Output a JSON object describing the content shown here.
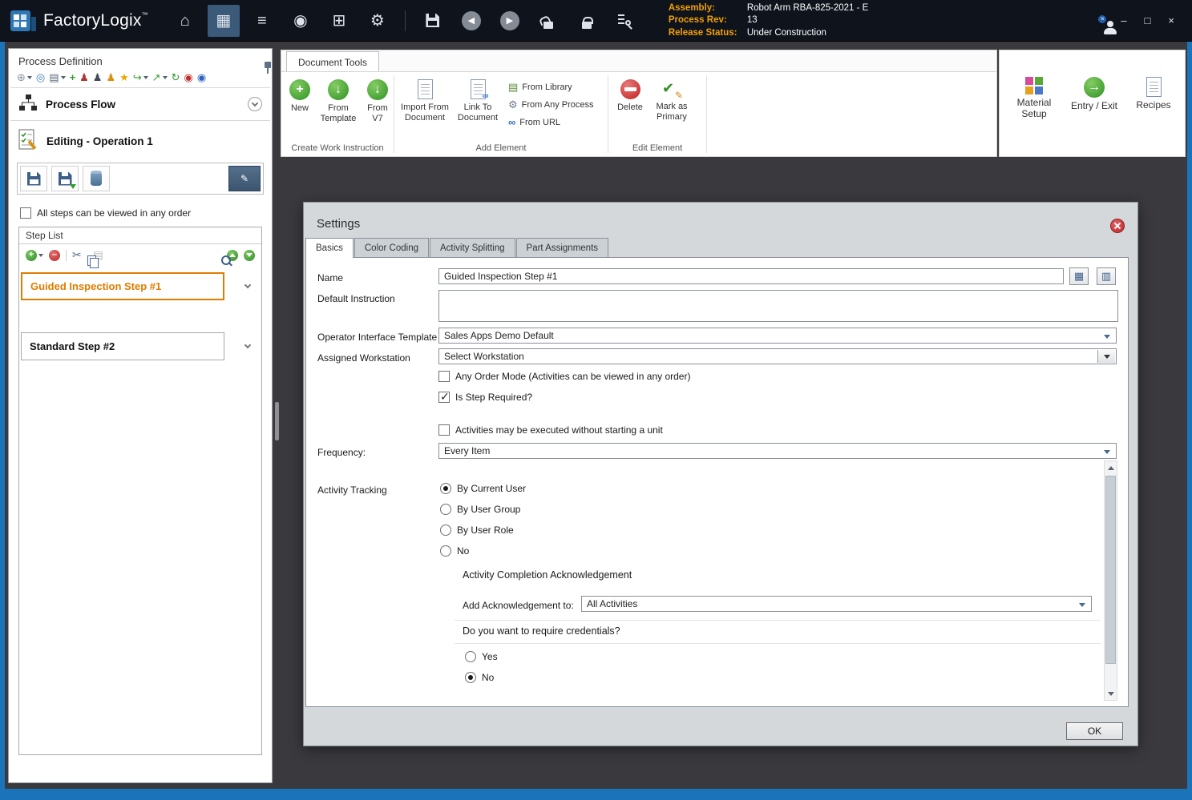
{
  "glyphs": {
    "home": "⌂",
    "work": "▦",
    "steps": "≡",
    "nav": "◉",
    "docs": "⊞",
    "gear": "⚙",
    "back": "◀",
    "fwd": "▶",
    "min": "–",
    "max": "□",
    "close": "×",
    "badge_x": "×",
    "sb": [
      "⊕",
      "◎",
      "▤",
      "+",
      "♟",
      "♟",
      "♟",
      "★",
      "↪",
      "↗",
      "↻",
      "◉",
      "◉"
    ],
    "cut": "✂",
    "paste": "▤",
    "pencil": "✎",
    "lib": "▤",
    "anyproc": "⚙",
    "url": "∞",
    "plus": "+",
    "minus": "–",
    "arrow_dn": "↓",
    "arrow_rt": "→",
    "fieldbtn1": "▦",
    "fieldbtn2": "▥"
  },
  "titlebar": {
    "app_name": "FactoryLogix",
    "trademark": "™",
    "info": {
      "assembly_label": "Assembly:",
      "assembly_value": "Robot Arm RBA-825-2021 - E",
      "process_rev_label": "Process Rev:",
      "process_rev_value": "13",
      "release_status_label": "Release Status:",
      "release_status_value": "Under Construction"
    }
  },
  "sidebar": {
    "title": "Process Definition",
    "process_flow_label": "Process Flow",
    "editing_label": "Editing - Operation 1",
    "any_order_label": "All steps can be viewed in any order",
    "any_order_checked": false,
    "step_list_title": "Step List",
    "steps": [
      {
        "label": "Guided Inspection Step #1",
        "selected": true
      },
      {
        "label": "Standard Step #2",
        "selected": false
      }
    ]
  },
  "ribbon": {
    "tab_label": "Document Tools",
    "create_group": {
      "label": "Create Work Instruction",
      "new": "New",
      "from_template": "From Template",
      "from_v7": "From V7"
    },
    "add_group": {
      "label": "Add Element",
      "import": "Import From Document",
      "link": "Link To Document",
      "from_library": "From Library",
      "from_any_process": "From Any Process",
      "from_url": "From URL"
    },
    "edit_group": {
      "label": "Edit Element",
      "delete": "Delete",
      "mark_primary": "Mark as Primary"
    },
    "right_group": {
      "material_setup": "Material Setup",
      "entry_exit": "Entry / Exit",
      "recipes": "Recipes"
    }
  },
  "dialog": {
    "title": "Settings",
    "tabs": [
      {
        "label": "Basics",
        "active": true
      },
      {
        "label": "Color Coding",
        "active": false
      },
      {
        "label": "Activity Splitting",
        "active": false
      },
      {
        "label": "Part Assignments",
        "active": false
      }
    ],
    "name_label": "Name",
    "name_value": "Guided Inspection Step #1",
    "default_instruction_label": "Default Instruction",
    "default_instruction_value": "",
    "operator_template_label": "Operator Interface Template",
    "operator_template_value": "Sales Apps Demo Default",
    "workstation_label": "Assigned Workstation",
    "workstation_value": "Select Workstation",
    "any_order_mode_label": "Any Order Mode (Activities can be viewed in any order)",
    "any_order_mode_checked": false,
    "step_required_label": "Is Step Required?",
    "step_required_checked": true,
    "no_unit_label": "Activities may be executed without starting a unit",
    "no_unit_checked": false,
    "frequency_label": "Frequency:",
    "frequency_value": "Every Item",
    "activity_tracking_label": "Activity Tracking",
    "tracking_options": [
      {
        "label": "By Current User",
        "selected": true
      },
      {
        "label": "By User Group",
        "selected": false
      },
      {
        "label": "By User Role",
        "selected": false
      },
      {
        "label": "No",
        "selected": false
      }
    ],
    "ack_heading": "Activity Completion Acknowledgement",
    "ack_label": "Add Acknowledgement to:",
    "ack_value": "All Activities",
    "credentials_question": "Do you want to require credentials?",
    "credentials_options": [
      {
        "label": "Yes",
        "selected": false
      },
      {
        "label": "No",
        "selected": true
      }
    ],
    "ok_label": "OK"
  }
}
